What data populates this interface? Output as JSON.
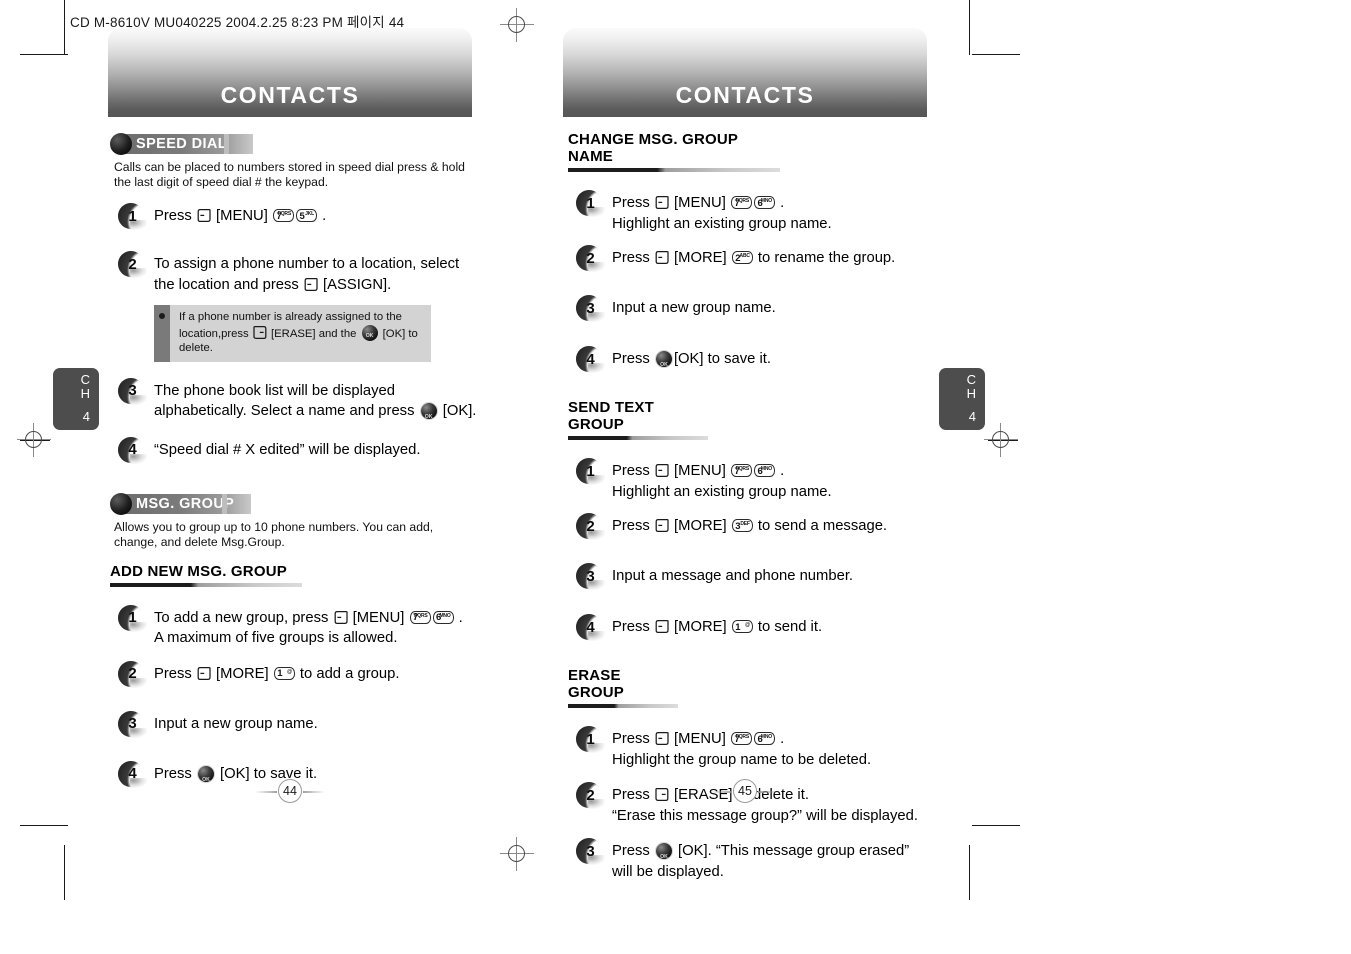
{
  "scan_header": "CD M-8610V MU040225  2004.2.25 8:23 PM 페이지 44",
  "pages": [
    {
      "banner_title": "CONTACTS",
      "folio": "44",
      "chapter_tab": {
        "line1": "C",
        "line2": "H",
        "number": "4"
      },
      "sections": [
        {
          "kind": "major",
          "title": "SPEED DIAL",
          "description": "Calls can be placed to numbers stored in speed dial press & hold the last digit of speed dial # the keypad.",
          "steps": [
            {
              "number": "1",
              "lines": [
                [
                  {
                    "t": "text",
                    "v": "Press "
                  },
                  {
                    "t": "icon",
                    "v": "softkey-left-icon"
                  },
                  {
                    "t": "text",
                    "v": " [MENU] "
                  },
                  {
                    "t": "key",
                    "digit": "7",
                    "sub": "PQRS"
                  },
                  {
                    "t": "key",
                    "digit": "5",
                    "sub": "JKL"
                  },
                  {
                    "t": "text",
                    "v": " ."
                  }
                ]
              ]
            },
            {
              "number": "2",
              "lines": [
                [
                  {
                    "t": "text",
                    "v": "To assign a phone number to a location, select"
                  }
                ],
                [
                  {
                    "t": "text",
                    "v": "the location and press "
                  },
                  {
                    "t": "icon",
                    "v": "softkey-left-icon"
                  },
                  {
                    "t": "text",
                    "v": " [ASSIGN]."
                  }
                ]
              ]
            }
          ],
          "note": {
            "lines": [
              [
                {
                  "t": "text",
                  "v": "If a phone number is already assigned to the location,"
                }
              ],
              [
                {
                  "t": "text",
                  "v": "press "
                },
                {
                  "t": "icon",
                  "v": "softkey-right-icon"
                },
                {
                  "t": "text",
                  "v": " [ERASE] and the "
                },
                {
                  "t": "ok",
                  "v": "ok-button-icon"
                },
                {
                  "t": "text",
                  "v": " [OK] to delete."
                }
              ]
            ]
          },
          "steps_after_note": [
            {
              "number": "3",
              "lines": [
                [
                  {
                    "t": "text",
                    "v": "The phone book list will be displayed"
                  }
                ],
                [
                  {
                    "t": "text",
                    "v": "alphabetically. Select a name and press "
                  },
                  {
                    "t": "ok",
                    "v": "ok-button-icon"
                  },
                  {
                    "t": "text",
                    "v": " [OK]."
                  }
                ]
              ]
            },
            {
              "number": "4",
              "lines": [
                [
                  {
                    "t": "text",
                    "v": "“Speed dial # X edited” will be displayed."
                  }
                ]
              ]
            }
          ]
        },
        {
          "kind": "major",
          "title": "MSG. GROUP",
          "description": "Allows you to group up to 10 phone numbers. You can add, change, and delete Msg.Group.",
          "subsections": [
            {
              "title": "ADD NEW MSG. GROUP",
              "steps": [
                {
                  "number": "1",
                  "lines": [
                    [
                      {
                        "t": "text",
                        "v": "To add a new group, press "
                      },
                      {
                        "t": "icon",
                        "v": "softkey-left-icon"
                      },
                      {
                        "t": "text",
                        "v": " [MENU] "
                      },
                      {
                        "t": "key",
                        "digit": "7",
                        "sub": "PQRS"
                      },
                      {
                        "t": "key",
                        "digit": "6",
                        "sub": "MNO"
                      },
                      {
                        "t": "text",
                        "v": " ."
                      }
                    ],
                    [
                      {
                        "t": "text",
                        "v": "A maximum of five groups is allowed."
                      }
                    ]
                  ]
                },
                {
                  "number": "2",
                  "lines": [
                    [
                      {
                        "t": "text",
                        "v": "Press "
                      },
                      {
                        "t": "icon",
                        "v": "softkey-left-icon"
                      },
                      {
                        "t": "text",
                        "v": " [MORE] "
                      },
                      {
                        "t": "key",
                        "digit": "1",
                        "sub": "@"
                      },
                      {
                        "t": "text",
                        "v": " to add a group."
                      }
                    ]
                  ]
                },
                {
                  "number": "3",
                  "lines": [
                    [
                      {
                        "t": "text",
                        "v": "Input a new group name."
                      }
                    ]
                  ]
                },
                {
                  "number": "4",
                  "lines": [
                    [
                      {
                        "t": "text",
                        "v": "Press "
                      },
                      {
                        "t": "ok",
                        "v": "ok-button-icon"
                      },
                      {
                        "t": "text",
                        "v": " [OK] to save it."
                      }
                    ]
                  ]
                }
              ]
            }
          ]
        }
      ]
    },
    {
      "banner_title": "CONTACTS",
      "folio": "45",
      "chapter_tab": {
        "line1": "C",
        "line2": "H",
        "number": "4"
      },
      "subsections": [
        {
          "title": "CHANGE MSG. GROUP NAME",
          "steps": [
            {
              "number": "1",
              "lines": [
                [
                  {
                    "t": "text",
                    "v": "Press "
                  },
                  {
                    "t": "icon",
                    "v": "softkey-left-icon"
                  },
                  {
                    "t": "text",
                    "v": " [MENU] "
                  },
                  {
                    "t": "key",
                    "digit": "7",
                    "sub": "PQRS"
                  },
                  {
                    "t": "key",
                    "digit": "6",
                    "sub": "MNO"
                  },
                  {
                    "t": "text",
                    "v": " ."
                  }
                ],
                [
                  {
                    "t": "text",
                    "v": "Highlight an existing group name."
                  }
                ]
              ]
            },
            {
              "number": "2",
              "lines": [
                [
                  {
                    "t": "text",
                    "v": "Press "
                  },
                  {
                    "t": "icon",
                    "v": "softkey-left-icon"
                  },
                  {
                    "t": "text",
                    "v": " [MORE] "
                  },
                  {
                    "t": "key",
                    "digit": "2",
                    "sub": "ABC"
                  },
                  {
                    "t": "text",
                    "v": " to rename the group."
                  }
                ]
              ]
            },
            {
              "number": "3",
              "lines": [
                [
                  {
                    "t": "text",
                    "v": "Input a new group name."
                  }
                ]
              ]
            },
            {
              "number": "4",
              "lines": [
                [
                  {
                    "t": "text",
                    "v": "Press "
                  },
                  {
                    "t": "ok",
                    "v": "ok-button-icon"
                  },
                  {
                    "t": "text",
                    "v": "[OK] to save it."
                  }
                ]
              ]
            }
          ]
        },
        {
          "title": "SEND TEXT GROUP",
          "steps": [
            {
              "number": "1",
              "lines": [
                [
                  {
                    "t": "text",
                    "v": "Press "
                  },
                  {
                    "t": "icon",
                    "v": "softkey-left-icon"
                  },
                  {
                    "t": "text",
                    "v": " [MENU] "
                  },
                  {
                    "t": "key",
                    "digit": "7",
                    "sub": "PQRS"
                  },
                  {
                    "t": "key",
                    "digit": "6",
                    "sub": "MNO"
                  },
                  {
                    "t": "text",
                    "v": " ."
                  }
                ],
                [
                  {
                    "t": "text",
                    "v": "Highlight an existing group name."
                  }
                ]
              ]
            },
            {
              "number": "2",
              "lines": [
                [
                  {
                    "t": "text",
                    "v": "Press "
                  },
                  {
                    "t": "icon",
                    "v": "softkey-left-icon"
                  },
                  {
                    "t": "text",
                    "v": " [MORE] "
                  },
                  {
                    "t": "key",
                    "digit": "3",
                    "sub": "DEF"
                  },
                  {
                    "t": "text",
                    "v": " to send a message."
                  }
                ]
              ]
            },
            {
              "number": "3",
              "lines": [
                [
                  {
                    "t": "text",
                    "v": "Input a message and phone number."
                  }
                ]
              ]
            },
            {
              "number": "4",
              "lines": [
                [
                  {
                    "t": "text",
                    "v": "Press "
                  },
                  {
                    "t": "icon",
                    "v": "softkey-left-icon"
                  },
                  {
                    "t": "text",
                    "v": " [MORE] "
                  },
                  {
                    "t": "key",
                    "digit": "1",
                    "sub": "@"
                  },
                  {
                    "t": "text",
                    "v": " to send it."
                  }
                ]
              ]
            }
          ]
        },
        {
          "title": "ERASE GROUP",
          "steps": [
            {
              "number": "1",
              "lines": [
                [
                  {
                    "t": "text",
                    "v": "Press "
                  },
                  {
                    "t": "icon",
                    "v": "softkey-left-icon"
                  },
                  {
                    "t": "text",
                    "v": " [MENU] "
                  },
                  {
                    "t": "key",
                    "digit": "7",
                    "sub": "PQRS"
                  },
                  {
                    "t": "key",
                    "digit": "6",
                    "sub": "MNO"
                  },
                  {
                    "t": "text",
                    "v": " ."
                  }
                ],
                [
                  {
                    "t": "text",
                    "v": "Highlight the group name to be deleted."
                  }
                ]
              ]
            },
            {
              "number": "2",
              "lines": [
                [
                  {
                    "t": "text",
                    "v": "Press "
                  },
                  {
                    "t": "icon",
                    "v": "softkey-right-icon"
                  },
                  {
                    "t": "text",
                    "v": " [ERASE] to delete it."
                  }
                ],
                [
                  {
                    "t": "text",
                    "v": "“Erase this message group?” will be displayed."
                  }
                ]
              ]
            },
            {
              "number": "3",
              "lines": [
                [
                  {
                    "t": "text",
                    "v": "Press "
                  },
                  {
                    "t": "ok",
                    "v": "ok-button-icon"
                  },
                  {
                    "t": "text",
                    "v": " [OK]. “This message group erased”"
                  }
                ],
                [
                  {
                    "t": "text",
                    "v": "will be displayed."
                  }
                ]
              ]
            }
          ]
        }
      ]
    }
  ]
}
